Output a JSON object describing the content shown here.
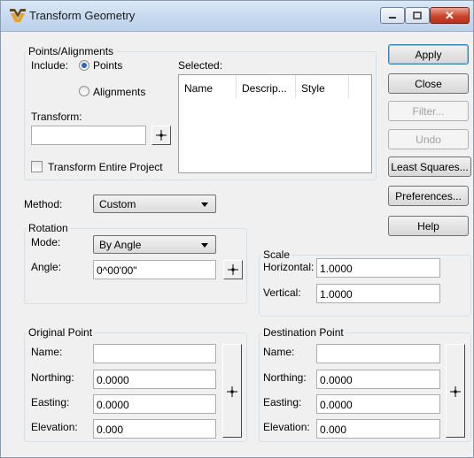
{
  "window": {
    "title": "Transform Geometry"
  },
  "points_alignments": {
    "legend": "Points/Alignments",
    "include_label": "Include:",
    "points_label": "Points",
    "alignments_label": "Alignments",
    "selected_label": "Selected:",
    "columns": [
      "Name",
      "Descrip...",
      "Style"
    ],
    "transform_label": "Transform:",
    "transform_value": "",
    "entire_project_label": "Transform Entire Project"
  },
  "method": {
    "label": "Method:",
    "value": "Custom"
  },
  "rotation": {
    "legend": "Rotation",
    "mode_label": "Mode:",
    "mode_value": "By Angle",
    "angle_label": "Angle:",
    "angle_value": "0^00'00\""
  },
  "scale": {
    "legend": "Scale",
    "horizontal_label": "Horizontal:",
    "horizontal_value": "1.0000",
    "vertical_label": "Vertical:",
    "vertical_value": "1.0000"
  },
  "original_point": {
    "legend": "Original Point",
    "name_label": "Name:",
    "name_value": "",
    "northing_label": "Northing:",
    "northing_value": "0.0000",
    "easting_label": "Easting:",
    "easting_value": "0.0000",
    "elevation_label": "Elevation:",
    "elevation_value": "0.000"
  },
  "destination_point": {
    "legend": "Destination Point",
    "name_label": "Name:",
    "name_value": "",
    "northing_label": "Northing:",
    "northing_value": "0.0000",
    "easting_label": "Easting:",
    "easting_value": "0.0000",
    "elevation_label": "Elevation:",
    "elevation_value": "0.000"
  },
  "buttons": {
    "apply": "Apply",
    "close": "Close",
    "filter": "Filter...",
    "undo": "Undo",
    "least_squares": "Least Squares...",
    "preferences": "Preferences...",
    "help": "Help"
  },
  "colors": {
    "accent": "#3c7fb1",
    "close_button": "#c9452b"
  }
}
